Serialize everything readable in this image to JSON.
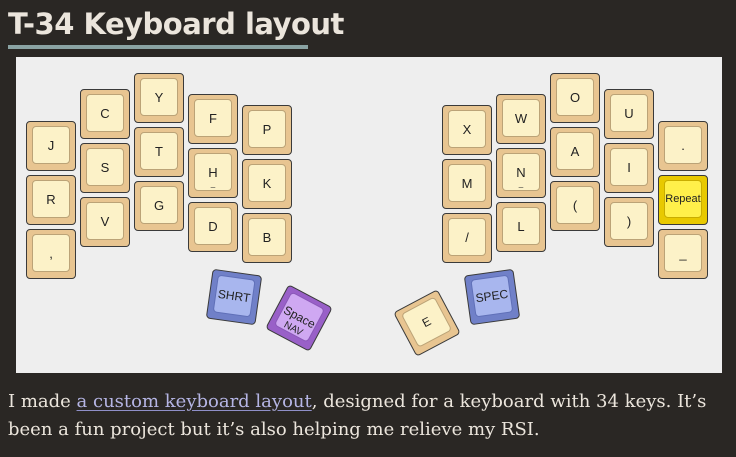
{
  "page": {
    "title": "T-34 Keyboard layout",
    "paragraph": {
      "before": "I made ",
      "link": "a custom keyboard layout",
      "after": ", designed for a keyboard with 34 keys. It’s been a fun project but it’s also helping me relieve my RSI."
    }
  },
  "keyboard": {
    "left_main": [
      {
        "label": "J"
      },
      {
        "label": "R"
      },
      {
        "label": ","
      },
      {
        "label": "C"
      },
      {
        "label": "S"
      },
      {
        "label": "V"
      },
      {
        "label": "Y"
      },
      {
        "label": "T"
      },
      {
        "label": "G"
      },
      {
        "label": "F"
      },
      {
        "label": "H",
        "sub": "_"
      },
      {
        "label": "D"
      },
      {
        "label": "P"
      },
      {
        "label": "K"
      },
      {
        "label": "B"
      }
    ],
    "right_main": [
      {
        "label": "X"
      },
      {
        "label": "M"
      },
      {
        "label": "/"
      },
      {
        "label": "W"
      },
      {
        "label": "N",
        "sub": "_"
      },
      {
        "label": "L"
      },
      {
        "label": "O"
      },
      {
        "label": "A"
      },
      {
        "label": "("
      },
      {
        "label": "U"
      },
      {
        "label": "I"
      },
      {
        "label": ")"
      },
      {
        "label": "."
      },
      {
        "label": "Repeat"
      },
      {
        "label": "_"
      }
    ],
    "thumbs": [
      {
        "label": "SHRT",
        "color": "blue"
      },
      {
        "label": "Space",
        "sub": "NAV",
        "color": "purple"
      },
      {
        "label": "E",
        "color": "tan"
      },
      {
        "label": "SPEC",
        "color": "blue"
      }
    ],
    "colors": {
      "key_base": "#e8c591",
      "key_top": "#fcf2c8",
      "repeat": "#fff04a",
      "blue": "#a8b6ee",
      "purple": "#cfa8f2",
      "background": "#2a2724",
      "link": "#b5b5e4"
    }
  }
}
